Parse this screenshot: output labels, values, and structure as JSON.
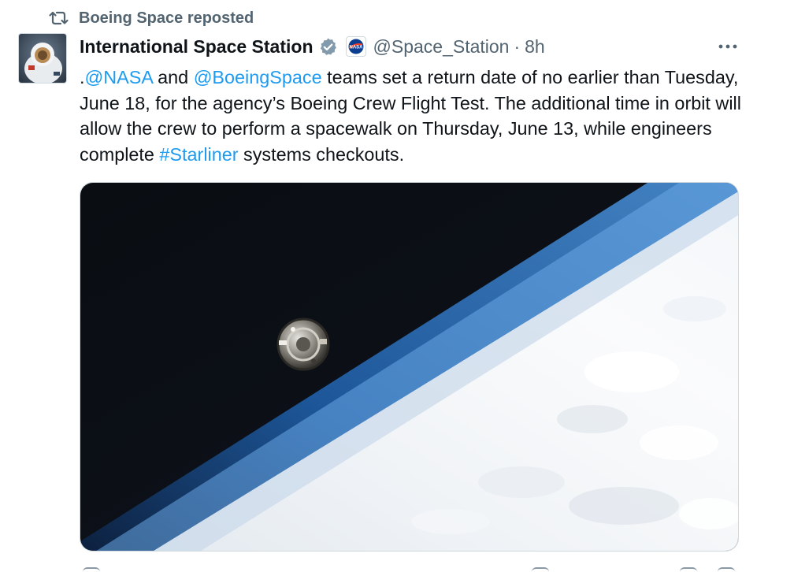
{
  "repost": {
    "icon": "repost-icon",
    "text": "Boeing Space reposted"
  },
  "author": {
    "avatar": "astronaut-avatar",
    "display_name": "International Space Station",
    "verified_icon": "verified-badge-icon",
    "affiliate_badge": "nasa-logo-badge",
    "handle": "@Space_Station",
    "separator": "·",
    "timestamp": "8h"
  },
  "more_menu": {
    "icon": "more-horizontal-icon"
  },
  "tweet": {
    "parts": [
      {
        "text": ".",
        "type": "text"
      },
      {
        "text": "@NASA",
        "type": "link"
      },
      {
        "text": " and ",
        "type": "text"
      },
      {
        "text": "@BoeingSpace",
        "type": "link"
      },
      {
        "text": " teams set a return date of no earlier than Tuesday, June 18, for the agency’s Boeing Crew Flight Test. The additional time in orbit will allow the crew to perform a spacewalk on Thursday, June 13, while engineers complete ",
        "type": "text"
      },
      {
        "text": "#Starliner",
        "type": "link"
      },
      {
        "text": " systems checkouts.",
        "type": "text"
      }
    ]
  },
  "media": {
    "description_icon": "photo-starliner-over-earth"
  },
  "colors": {
    "link": "#1d9bf0",
    "secondary_text": "#536471",
    "primary_text": "#0f1419",
    "verified": "#829aab"
  }
}
